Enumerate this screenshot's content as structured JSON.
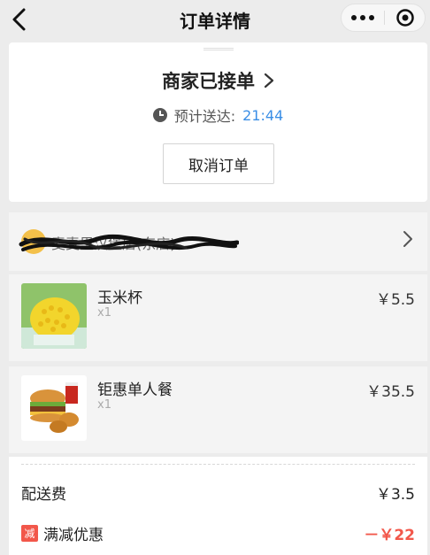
{
  "nav": {
    "title": "订单详情",
    "back_icon": "chevron-left-icon",
    "more_icon": "more-dots-icon",
    "close_icon": "target-circle-icon"
  },
  "status": {
    "text": "商家已接单",
    "eta_label": "预计送达: ",
    "eta_time": "21:44",
    "cancel_label": "取消订单"
  },
  "shop": {
    "name": "麦麦里汉堡店(东店)",
    "name_obscured": true
  },
  "items": [
    {
      "name": "玉米杯",
      "qty": "x1",
      "price": "￥5.5"
    },
    {
      "name": "钜惠单人餐",
      "qty": "x1",
      "price": "￥35.5"
    }
  ],
  "fees": {
    "delivery_label": "配送费",
    "delivery_value": "￥3.5",
    "discount_badge": "减",
    "discount_label": "满减优惠",
    "discount_value": "－￥22"
  },
  "colors": {
    "accent_blue": "#3a8ee6",
    "discount_red": "#f2574a",
    "background": "#ececec"
  }
}
